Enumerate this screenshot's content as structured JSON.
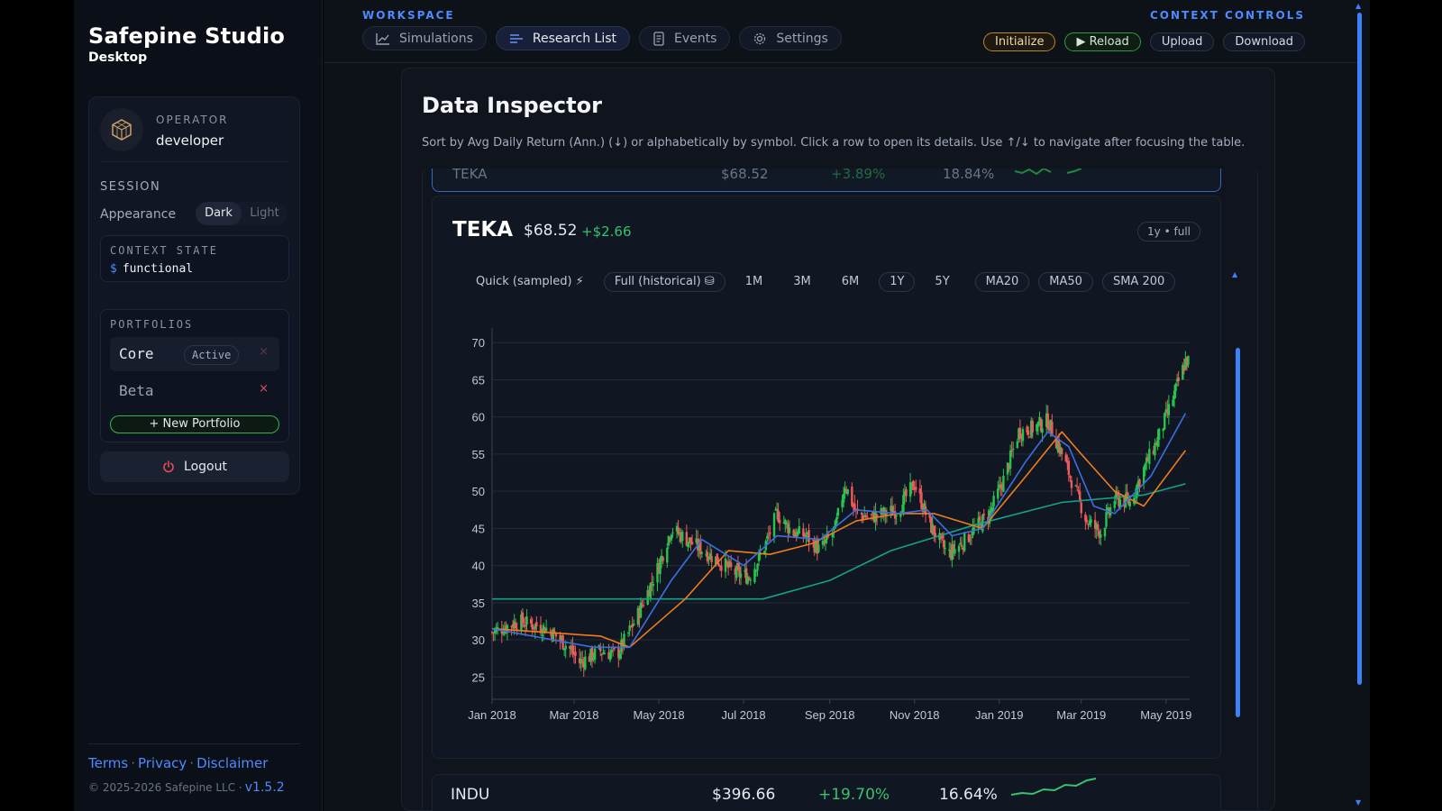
{
  "app": {
    "title": "Safepine Studio",
    "subtitle": "Desktop"
  },
  "operator": {
    "label": "OPERATOR",
    "name": "developer"
  },
  "session": {
    "label": "SESSION",
    "appearance_label": "Appearance",
    "appearance_options": [
      "Dark",
      "Light"
    ],
    "appearance_selected": "Dark"
  },
  "context": {
    "label": "CONTEXT STATE",
    "prompt": "$",
    "value": "functional"
  },
  "portfolios": {
    "label": "PORTFOLIOS",
    "items": [
      {
        "name": "Core",
        "badge": "Active",
        "remove": "×"
      },
      {
        "name": "Beta",
        "remove": "×"
      }
    ],
    "new_label": "+ New Portfolio"
  },
  "logout_label": "Logout",
  "footer": {
    "terms": "Terms",
    "privacy": "Privacy",
    "disclaimer": "Disclaimer",
    "sep": "·",
    "copyright": "© 2025-2026 Safepine LLC ·",
    "version": "v1.5.2"
  },
  "workspace": {
    "label": "WORKSPACE",
    "tabs": [
      {
        "label": "Simulations",
        "icon": "chart-line-icon"
      },
      {
        "label": "Research List",
        "icon": "list-icon"
      },
      {
        "label": "Events",
        "icon": "document-icon"
      },
      {
        "label": "Settings",
        "icon": "gear-icon"
      }
    ],
    "active_tab": "Research List"
  },
  "context_controls": {
    "label": "CONTEXT CONTROLS",
    "initialize": "Initialize",
    "reload": "▶ Reload",
    "upload": "Upload",
    "download": "Download"
  },
  "inspector": {
    "title": "Data Inspector",
    "description": "Sort by Avg Daily Return (Ann.) (↓) or alphabetically by symbol. Click a row to open its details. Use ↑/↓ to navigate after focusing the table."
  },
  "partial_row": {
    "symbol": "TEKA",
    "price": "$68.52",
    "return": "+3.89%",
    "vol": "18.84%"
  },
  "detail": {
    "symbol": "TEKA",
    "price": "$68.52",
    "change": "+$2.66",
    "range_badge": "1y • full",
    "buttons": [
      "Quick (sampled) ⚡",
      "Full (historical) ⛁",
      "1M",
      "3M",
      "6M",
      "1Y",
      "5Y",
      "MA20",
      "MA50",
      "SMA 200"
    ]
  },
  "bottom_row": {
    "symbol": "INDU",
    "price": "$396.66",
    "return": "+19.70%",
    "vol": "16.64%"
  },
  "colors": {
    "up": "#26c44f",
    "down": "#ef5a5a",
    "ma20": "#3b6fe0",
    "ma50": "#f07c1a",
    "sma200": "#17a08a",
    "accent": "#4d8bff"
  },
  "chart_data": {
    "type": "candlestick",
    "x_axis": {
      "type": "date",
      "ticks": [
        "Jan 2018",
        "Mar 2018",
        "May 2018",
        "Jul 2018",
        "Sep 2018",
        "Nov 2018",
        "Jan 2019",
        "Mar 2019",
        "May 2019"
      ]
    },
    "y_axis": {
      "ticks": [
        25,
        30,
        35,
        40,
        45,
        50,
        55,
        60,
        65,
        70
      ],
      "ylim": [
        22,
        71
      ]
    },
    "grid": true,
    "close_path": [
      [
        "2018-01-01",
        31
      ],
      [
        "2018-01-20",
        32.5
      ],
      [
        "2018-02-10",
        31.5
      ],
      [
        "2018-02-25",
        29
      ],
      [
        "2018-03-05",
        27
      ],
      [
        "2018-03-20",
        28.5
      ],
      [
        "2018-04-01",
        28
      ],
      [
        "2018-04-15",
        33
      ],
      [
        "2018-05-01",
        40
      ],
      [
        "2018-05-10",
        45
      ],
      [
        "2018-05-25",
        43
      ],
      [
        "2018-06-10",
        41
      ],
      [
        "2018-06-25",
        39
      ],
      [
        "2018-07-05",
        38.5
      ],
      [
        "2018-07-15",
        42
      ],
      [
        "2018-07-25",
        47
      ],
      [
        "2018-08-05",
        44.5
      ],
      [
        "2018-08-15",
        44
      ],
      [
        "2018-08-25",
        42
      ],
      [
        "2018-09-05",
        45
      ],
      [
        "2018-09-12",
        51
      ],
      [
        "2018-09-20",
        47
      ],
      [
        "2018-09-30",
        46.5
      ],
      [
        "2018-10-10",
        47
      ],
      [
        "2018-10-20",
        47.5
      ],
      [
        "2018-11-01",
        51
      ],
      [
        "2018-11-12",
        45.5
      ],
      [
        "2018-11-25",
        41.5
      ],
      [
        "2018-12-05",
        43
      ],
      [
        "2018-12-15",
        45
      ],
      [
        "2018-12-25",
        47
      ],
      [
        "2019-01-05",
        52
      ],
      [
        "2019-01-15",
        58
      ],
      [
        "2019-01-25",
        58.5
      ],
      [
        "2019-02-05",
        59.5
      ],
      [
        "2019-02-15",
        55
      ],
      [
        "2019-02-25",
        50
      ],
      [
        "2019-03-05",
        46
      ],
      [
        "2019-03-15",
        44.5
      ],
      [
        "2019-03-25",
        49
      ],
      [
        "2019-04-05",
        48.5
      ],
      [
        "2019-04-15",
        53
      ],
      [
        "2019-04-25",
        57
      ],
      [
        "2019-05-05",
        62
      ],
      [
        "2019-05-15",
        67.5
      ]
    ],
    "ma20": [
      [
        "2018-01-01",
        31.5
      ],
      [
        "2018-03-15",
        29
      ],
      [
        "2018-04-10",
        29
      ],
      [
        "2018-05-10",
        38
      ],
      [
        "2018-06-01",
        43.5
      ],
      [
        "2018-07-01",
        40
      ],
      [
        "2018-07-25",
        44
      ],
      [
        "2018-08-25",
        43.5
      ],
      [
        "2018-09-20",
        47.5
      ],
      [
        "2018-10-20",
        47
      ],
      [
        "2018-11-10",
        47.5
      ],
      [
        "2018-11-28",
        44
      ],
      [
        "2018-12-20",
        45
      ],
      [
        "2019-01-20",
        54
      ],
      [
        "2019-02-05",
        58
      ],
      [
        "2019-02-20",
        56
      ],
      [
        "2019-03-10",
        48
      ],
      [
        "2019-03-25",
        47
      ],
      [
        "2019-04-20",
        52
      ],
      [
        "2019-05-15",
        60.5
      ]
    ],
    "ma50": [
      [
        "2018-01-01",
        31.5
      ],
      [
        "2018-03-20",
        30.5
      ],
      [
        "2018-04-10",
        29
      ],
      [
        "2018-05-20",
        35.5
      ],
      [
        "2018-06-20",
        42
      ],
      [
        "2018-07-20",
        41.5
      ],
      [
        "2018-08-20",
        43
      ],
      [
        "2018-09-20",
        46
      ],
      [
        "2018-10-20",
        47
      ],
      [
        "2018-11-15",
        47
      ],
      [
        "2018-12-20",
        45
      ],
      [
        "2019-01-20",
        52
      ],
      [
        "2019-02-15",
        58
      ],
      [
        "2019-03-01",
        55
      ],
      [
        "2019-03-25",
        50
      ],
      [
        "2019-04-15",
        48
      ],
      [
        "2019-05-15",
        55.5
      ]
    ],
    "sma200": [
      [
        "2018-01-01",
        35.5
      ],
      [
        "2018-07-15",
        35.5
      ],
      [
        "2018-09-01",
        38
      ],
      [
        "2018-10-15",
        42
      ],
      [
        "2018-12-15",
        45.5
      ],
      [
        "2019-02-15",
        48.5
      ],
      [
        "2019-04-15",
        49.5
      ],
      [
        "2019-05-15",
        51
      ]
    ]
  }
}
